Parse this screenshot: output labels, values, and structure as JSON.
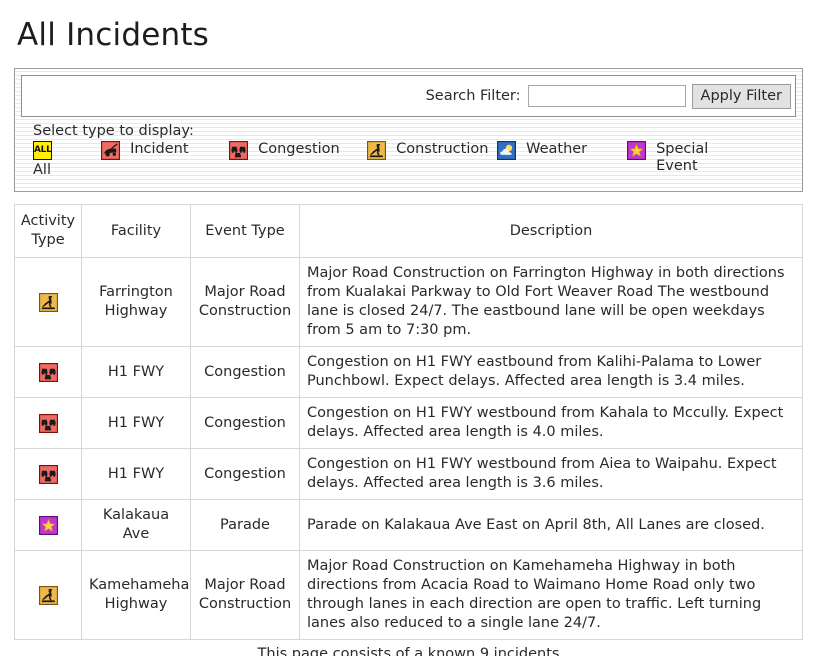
{
  "page": {
    "title": "All Incidents"
  },
  "filter": {
    "search_label": "Search Filter:",
    "search_value": "",
    "search_placeholder": "",
    "apply_label": "Apply Filter",
    "select_type_label": "Select type to display:",
    "types": [
      {
        "label": "All",
        "icon": "all-icon",
        "icon_text": "ALL",
        "bg": "#ffef00",
        "border": "#111111"
      },
      {
        "label": "Incident",
        "icon": "incident-car-icon",
        "bg": "#ef6a63",
        "border": "#7d1010"
      },
      {
        "label": "Congestion",
        "icon": "congestion-cars-icon",
        "bg": "#ef6a63",
        "border": "#7d1010"
      },
      {
        "label": "Construction",
        "icon": "construction-worker-icon",
        "bg": "#f0b84b",
        "border": "#7a5510"
      },
      {
        "label": "Weather",
        "icon": "weather-sun-cloud-icon",
        "bg": "#2f6fc4",
        "border": "#13335f"
      },
      {
        "label": "Special Event",
        "icon": "special-event-star-icon",
        "bg": "#c432d8",
        "border": "#5d1268"
      }
    ]
  },
  "table": {
    "columns": [
      "Activity Type",
      "Facility",
      "Event Type",
      "Description"
    ],
    "rows": [
      {
        "icon": "construction-worker-icon",
        "facility": "Farrington Highway",
        "event_type": "Major Road Construction",
        "description": "Major Road Construction on Farrington Highway in both directions from Kualakai Parkway to Old Fort Weaver Road The westbound lane is closed 24/7. The eastbound lane will be open weekdays from 5 am to 7:30 pm."
      },
      {
        "icon": "congestion-cars-icon",
        "facility": "H1 FWY",
        "event_type": "Congestion",
        "description": "Congestion on H1 FWY eastbound from Kalihi-Palama to Lower Punchbowl. Expect delays. Affected area length is 3.4 miles."
      },
      {
        "icon": "congestion-cars-icon",
        "facility": "H1 FWY",
        "event_type": "Congestion",
        "description": "Congestion on H1 FWY westbound from Kahala to Mccully. Expect delays. Affected area length is 4.0 miles."
      },
      {
        "icon": "congestion-cars-icon",
        "facility": "H1 FWY",
        "event_type": "Congestion",
        "description": "Congestion on H1 FWY westbound from Aiea to Waipahu. Expect delays. Affected area length is 3.6 miles."
      },
      {
        "icon": "special-event-star-icon",
        "facility": "Kalakaua Ave",
        "event_type": "Parade",
        "description": "Parade on Kalakaua Ave East on April 8th, All Lanes are closed."
      },
      {
        "icon": "construction-worker-icon",
        "facility": "Kamehameha Highway",
        "event_type": "Major Road Construction",
        "description": "Major Road Construction on Kamehameha Highway in both directions from Acacia Road to Waimano Home Road only two through lanes in each direction are open to traffic. Left turning lanes also reduced to a single lane 24/7."
      }
    ]
  },
  "footer": {
    "note": "This page consists of a known 9 incidents"
  }
}
